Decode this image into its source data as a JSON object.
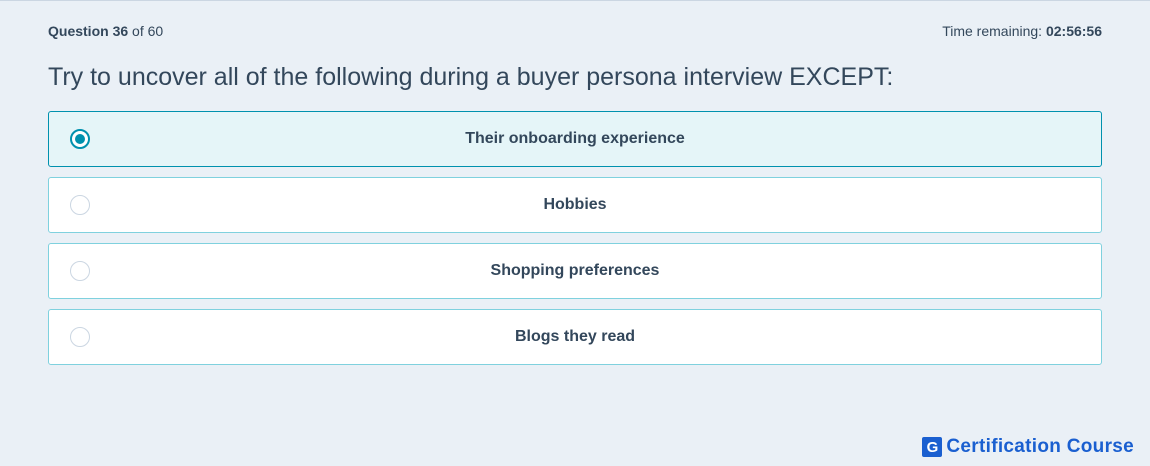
{
  "header": {
    "question_label": "Question",
    "question_number": "36",
    "question_of": "of 60",
    "time_label": "Time remaining:",
    "time_value": "02:56:56"
  },
  "question": {
    "text": "Try to uncover all of the following during a buyer persona interview EXCEPT:"
  },
  "options": [
    {
      "label": "Their onboarding experience",
      "selected": true
    },
    {
      "label": "Hobbies",
      "selected": false
    },
    {
      "label": "Shopping preferences",
      "selected": false
    },
    {
      "label": "Blogs they read",
      "selected": false
    }
  ],
  "brand": {
    "logo_letter": "G",
    "text": "Certification Course",
    "color": "#1a5fd0"
  },
  "colors": {
    "background": "#eaf0f6",
    "text": "#33475b",
    "accent": "#0091ae",
    "option_border": "#7fd1de",
    "selected_bg": "#e5f5f8"
  }
}
